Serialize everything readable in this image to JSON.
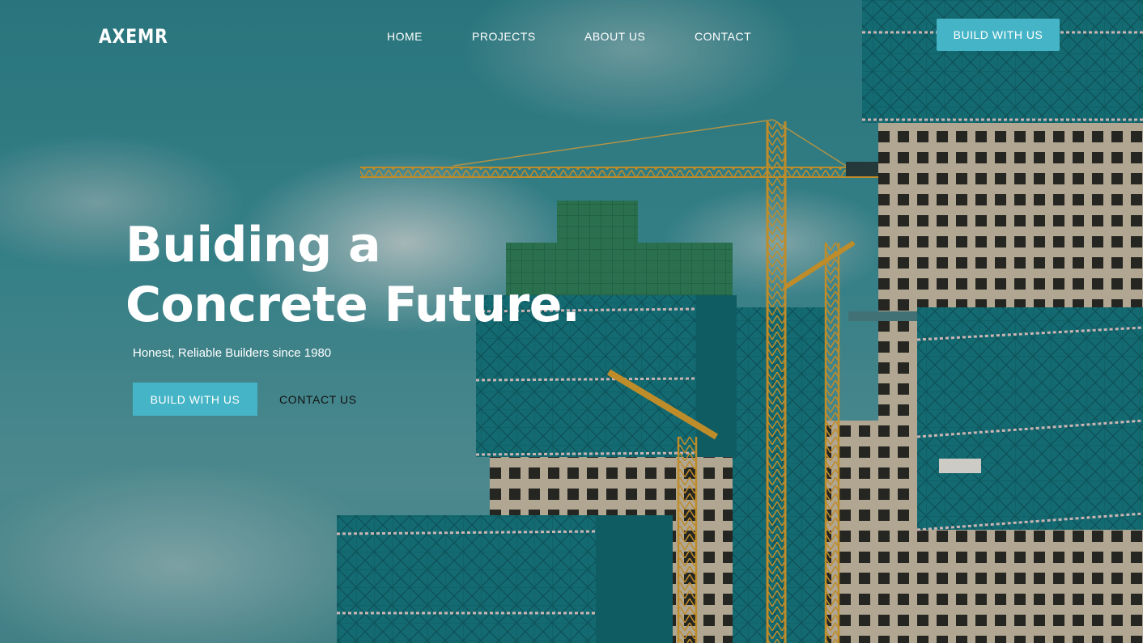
{
  "brand": {
    "logo_text": "AXEMR"
  },
  "nav": {
    "links": [
      "HOME",
      "PROJECTS",
      "ABOUT US",
      "CONTACT"
    ],
    "cta_label": "BUILD WITH US"
  },
  "hero": {
    "headline_line1": "Buiding a",
    "headline_line2": "Concrete Future.",
    "subheadline": "Honest, Reliable Builders since 1980",
    "primary_cta": "BUILD WITH US",
    "secondary_cta": "CONTACT US"
  },
  "colors": {
    "accent": "#45b4c6",
    "sky": "#3b8b93",
    "netting": "#16737c",
    "crane": "#d99a2b"
  }
}
